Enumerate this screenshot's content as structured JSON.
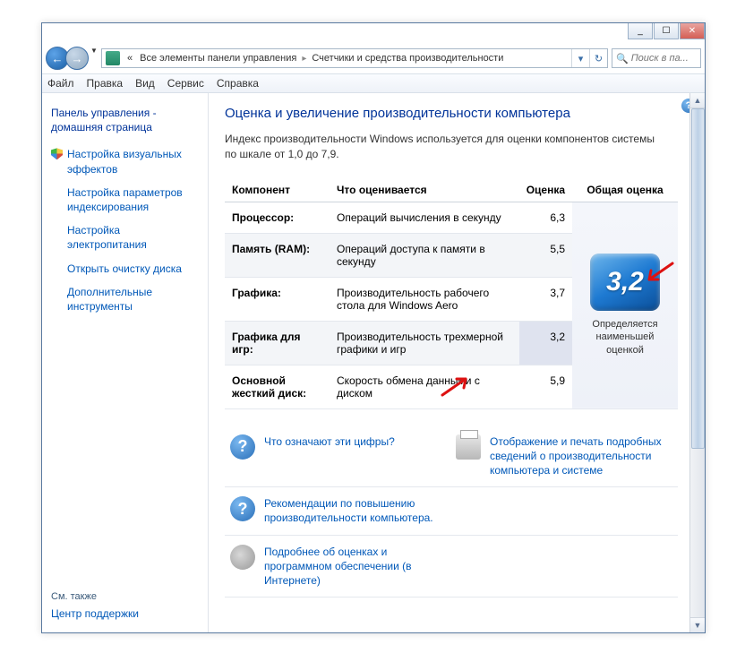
{
  "titlebar": {
    "min": "_",
    "max": "☐",
    "close": "✕"
  },
  "nav": {
    "back": "←",
    "fwd": "→",
    "drop": "▼"
  },
  "breadcrumb": {
    "prefix": "«",
    "seg1": "Все элементы панели управления",
    "seg2": "Счетчики и средства производительности",
    "refresh": "↻"
  },
  "search": {
    "placeholder": "Поиск в па..."
  },
  "menu": {
    "file": "Файл",
    "edit": "Правка",
    "view": "Вид",
    "tools": "Сервис",
    "help": "Справка"
  },
  "sidebar": {
    "home": "Панель управления - домашняя страница",
    "items": [
      "Настройка визуальных эффектов",
      "Настройка параметров индексирования",
      "Настройка электропитания",
      "Открыть очистку диска",
      "Дополнительные инструменты"
    ],
    "see_also": "См. также",
    "action_center": "Центр поддержки"
  },
  "content": {
    "heading": "Оценка и увеличение производительности компьютера",
    "intro": "Индекс производительности Windows используется для оценки компонентов системы по шкале от 1,0 до 7,9.",
    "cols": {
      "component": "Компонент",
      "what": "Что оценивается",
      "score": "Оценка",
      "overall": "Общая оценка"
    },
    "rows": [
      {
        "name": "Процессор:",
        "what": "Операций вычисления в секунду",
        "score": "6,3"
      },
      {
        "name": "Память (RAM):",
        "what": "Операций доступа к памяти в секунду",
        "score": "5,5"
      },
      {
        "name": "Графика:",
        "what": "Производительность рабочего стола для Windows Aero",
        "score": "3,7"
      },
      {
        "name": "Графика для игр:",
        "what": "Производительность трехмерной графики и игр",
        "score": "3,2"
      },
      {
        "name": "Основной жесткий диск:",
        "what": "Скорость обмена данными с диском",
        "score": "5,9"
      }
    ],
    "overall_score": "3,2",
    "overall_caption": "Определяется наименьшей оценкой",
    "links": {
      "what_numbers": "Что означают эти цифры?",
      "print_details": "Отображение и печать подробных сведений о производительности компьютера и системе",
      "recommendations": "Рекомендации по повышению производительности компьютера.",
      "learn_more": "Подробнее об оценках и программном обеспечении (в Интернете)"
    }
  },
  "help_q": "?"
}
